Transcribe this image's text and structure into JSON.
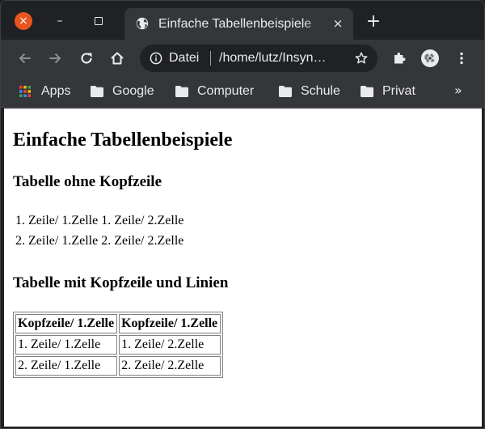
{
  "window": {
    "close_glyph": "×",
    "minimize_glyph": "–"
  },
  "tab": {
    "title": "Einfache Tabellenbeispiele",
    "close_glyph": "×",
    "new_tab_glyph": "+"
  },
  "omnibox": {
    "security_label": "Datei",
    "url": "/home/lutz/Insyn…"
  },
  "bookmarks": {
    "items": [
      {
        "label": "Apps",
        "icon": "apps-grid-icon"
      },
      {
        "label": "Google",
        "icon": "folder-icon"
      },
      {
        "label": "Computer",
        "icon": "folder-icon"
      },
      {
        "label": "Schule",
        "icon": "folder-icon"
      },
      {
        "label": "Privat",
        "icon": "folder-icon"
      }
    ],
    "more_glyph": "»"
  },
  "page": {
    "title": "Einfache Tabellenbeispiele",
    "section1": {
      "heading": "Tabelle ohne Kopfzeile",
      "rows": [
        [
          "1. Zeile/ 1.Zelle",
          "1. Zeile/ 2.Zelle"
        ],
        [
          "2. Zeile/ 1.Zelle",
          "2. Zeile/ 2.Zelle"
        ]
      ]
    },
    "section2": {
      "heading": "Tabelle mit Kopfzeile und Linien",
      "headers": [
        "Kopfzeile/ 1.Zelle",
        "Kopfzeile/ 1.Zelle"
      ],
      "rows": [
        [
          "1. Zeile/ 1.Zelle",
          "1. Zeile/ 2.Zelle"
        ],
        [
          "2. Zeile/ 1.Zelle",
          "2. Zeile/ 2.Zelle"
        ]
      ]
    }
  },
  "colors": {
    "chrome_dark": "#202124",
    "chrome_toolbar": "#35363a",
    "close_button": "#e95420",
    "text_light": "#e8eaed",
    "table_border": "#808080"
  }
}
